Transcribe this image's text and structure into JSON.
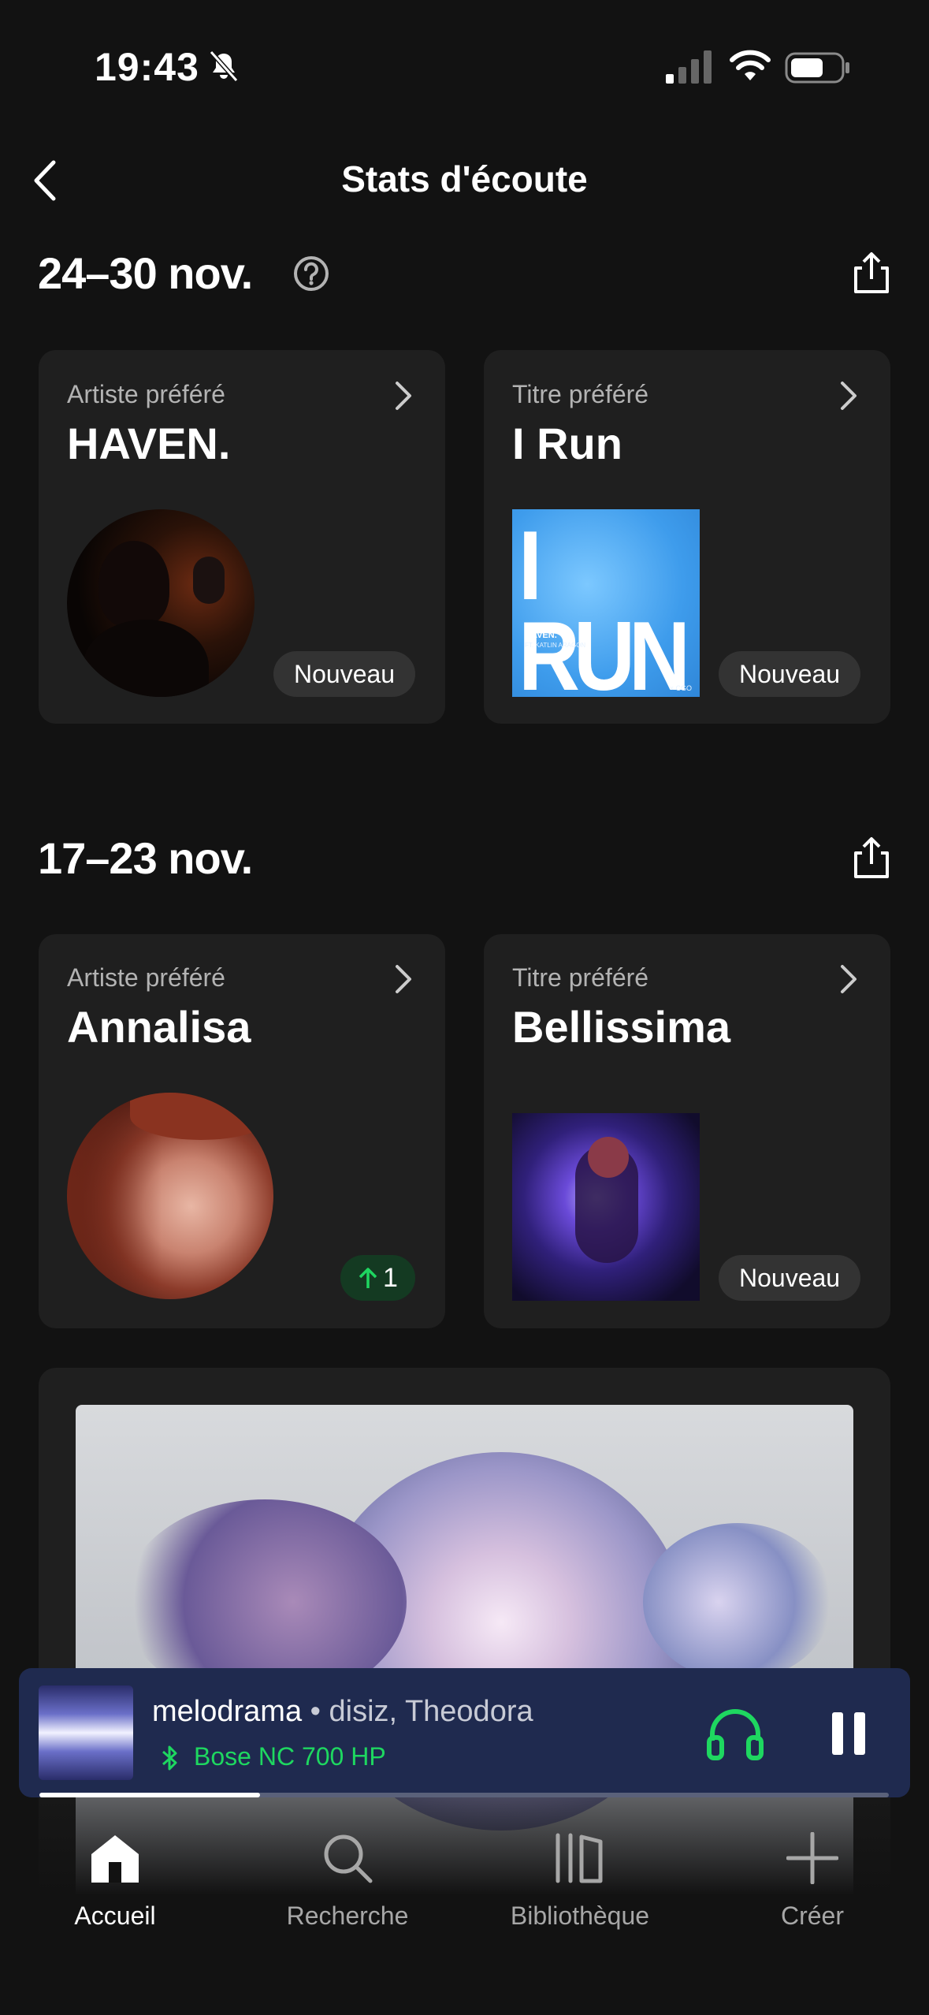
{
  "status_bar": {
    "time": "19:43"
  },
  "header": {
    "title": "Stats d'écoute"
  },
  "weeks": [
    {
      "title": "24–30 nov.",
      "artist_card": {
        "label": "Artiste préféré",
        "value": "HAVEN.",
        "badge": "Nouveau"
      },
      "track_card": {
        "label": "Titre préféré",
        "value": "I Run",
        "badge": "Nouveau",
        "cover_text": "I RUN",
        "cover_small_1": "HAVEN.",
        "cover_small_2": "FT. KATLIN ARAGON",
        "cover_corner": "× CGO"
      }
    },
    {
      "title": "17–23 nov.",
      "artist_card": {
        "label": "Artiste préféré",
        "value": "Annalisa",
        "badge": "1"
      },
      "track_card": {
        "label": "Titre préféré",
        "value": "Bellissima",
        "badge": "Nouveau"
      }
    }
  ],
  "player": {
    "track": "melodrama",
    "artists": " • disiz, Theodora",
    "device": "Bose NC 700 HP",
    "progress": 0.26
  },
  "nav": {
    "items": [
      {
        "label": "Accueil",
        "icon": "home-icon",
        "active": true
      },
      {
        "label": "Recherche",
        "icon": "search-icon",
        "active": false
      },
      {
        "label": "Bibliothèque",
        "icon": "library-icon",
        "active": false
      },
      {
        "label": "Créer",
        "icon": "plus-icon",
        "active": false
      }
    ]
  },
  "colors": {
    "accent": "#1ed760",
    "background": "#121212",
    "card": "#1f1f1f",
    "player": "#1f2a4f"
  }
}
